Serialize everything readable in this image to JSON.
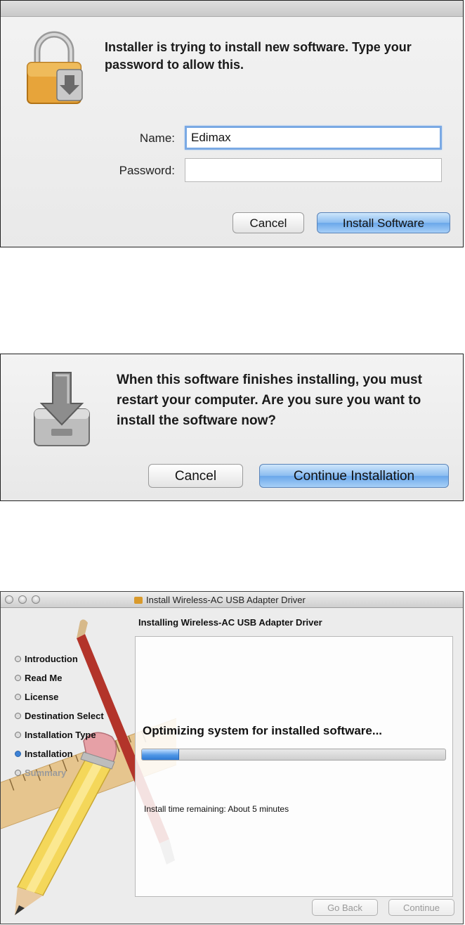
{
  "password_dialog": {
    "message": "Installer is trying to install new software. Type your password to allow this.",
    "name_label": "Name:",
    "name_value": "Edimax",
    "password_label": "Password:",
    "password_value": "",
    "cancel_label": "Cancel",
    "install_label": "Install Software",
    "icon": "lock-icon"
  },
  "restart_dialog": {
    "message": "When this software finishes installing, you must restart your computer. Are you sure you want to install the software now?",
    "cancel_label": "Cancel",
    "continue_label": "Continue Installation",
    "icon": "disk-download-icon"
  },
  "installer_window": {
    "title": "Install Wireless-AC USB Adapter Driver",
    "subtitle": "Installing Wireless-AC USB Adapter Driver",
    "steps": [
      {
        "label": "Introduction",
        "state": "done"
      },
      {
        "label": "Read Me",
        "state": "done"
      },
      {
        "label": "License",
        "state": "done"
      },
      {
        "label": "Destination Select",
        "state": "done"
      },
      {
        "label": "Installation Type",
        "state": "done"
      },
      {
        "label": "Installation",
        "state": "active"
      },
      {
        "label": "Summary",
        "state": "future"
      }
    ],
    "status": "Optimizing system for installed software...",
    "progress": 0.12,
    "time_remaining": "Install time remaining: About 5 minutes",
    "go_back_label": "Go Back",
    "continue_label": "Continue",
    "accent_color": "#3d82d6"
  }
}
